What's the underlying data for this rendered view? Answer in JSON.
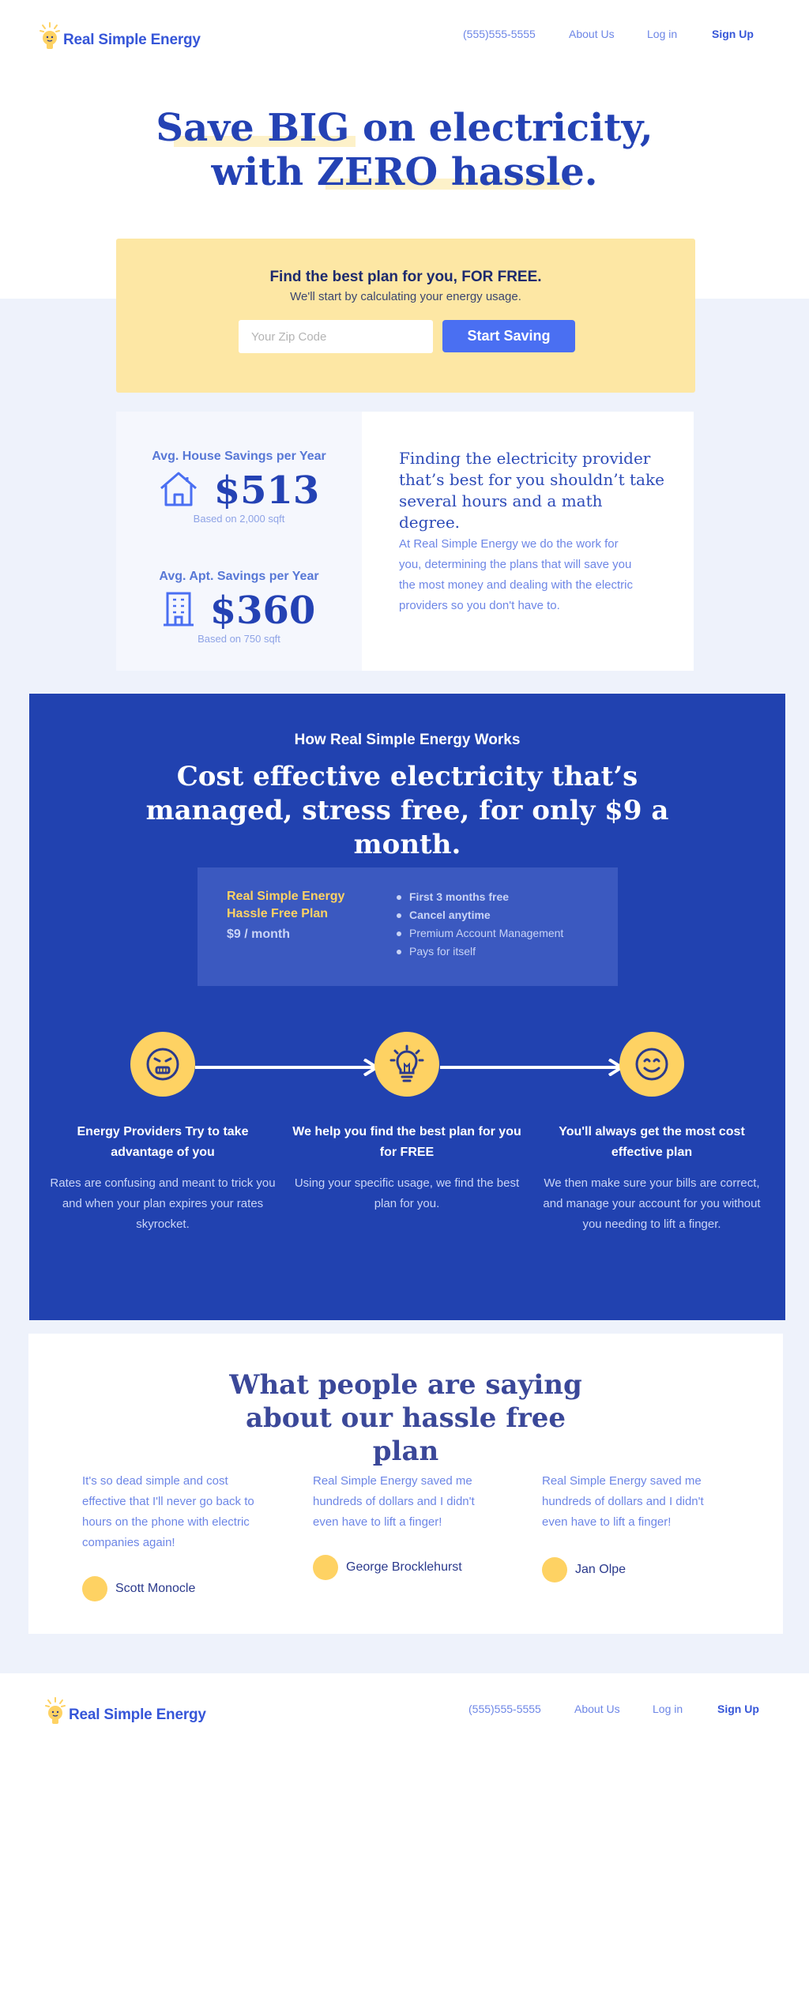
{
  "brand": {
    "name": "Real Simple Energy",
    "colors": {
      "primary": "#2442b4",
      "accent": "#4a6ff2",
      "yellow": "#fed263",
      "panel": "#fde7a4"
    }
  },
  "nav": {
    "phone": "(555)555-5555",
    "about": "About Us",
    "login": "Log in",
    "signup": "Sign Up"
  },
  "hero": {
    "line1": "Save BIG on electricity,",
    "line2": "with ZERO hassle."
  },
  "signup": {
    "title": "Find the best plan for you, FOR FREE.",
    "subtitle": "We'll start by calculating your energy usage.",
    "zip_placeholder": "Your Zip Code",
    "button": "Start Saving"
  },
  "savings": {
    "house": {
      "label": "Avg. House Savings per Year",
      "value": "$513",
      "note": "Based on 2,000 sqft",
      "icon": "house-icon"
    },
    "apt": {
      "label": "Avg. Apt. Savings per Year",
      "value": "$360",
      "note": "Based on 750 sqft",
      "icon": "building-icon"
    },
    "heading": "Finding the electricity provider that’s best for you shouldn’t take several hours and a math degree.",
    "body": "At Real Simple Energy we do the work for you, determining the plans that will save you the most money and dealing with the electric providers so you don't have to."
  },
  "how": {
    "eyebrow": "How Real Simple Energy Works",
    "title": "Cost effective electricity that’s managed, stress free, for only $9 a month.",
    "plan": {
      "name": "Real Simple Energy Hassle Free Plan",
      "price": "$9 / month",
      "features": [
        "First 3 months free",
        "Cancel anytime",
        "Premium Account Management",
        "Pays for itself"
      ]
    },
    "steps": [
      {
        "icon": "angry-face-icon",
        "title": "Energy Providers Try to take advantage of you",
        "body": "Rates are confusing and meant to trick you and when your plan expires your rates skyrocket."
      },
      {
        "icon": "lightbulb-icon",
        "title": "We help you find the best plan for you for FREE",
        "body": "Using your specific usage, we find the best plan for you."
      },
      {
        "icon": "smile-face-icon",
        "title": "You'll always get the most cost effective plan",
        "body": "We then make sure your bills are correct, and manage your account for you without you needing to lift a finger."
      }
    ]
  },
  "testimonials": {
    "title": "What people are saying about our hassle free plan",
    "items": [
      {
        "quote": "It's so dead simple and cost effective that I'll never go back to hours on the phone with electric companies again!",
        "name": "Scott Monocle"
      },
      {
        "quote": "Real Simple Energy saved me hundreds of dollars and I didn't even have to lift a finger!",
        "name": "George Brocklehurst"
      },
      {
        "quote": "Real Simple Energy saved me hundreds of dollars and I didn't even have to lift a finger!",
        "name": "Jan Olpe"
      }
    ]
  }
}
